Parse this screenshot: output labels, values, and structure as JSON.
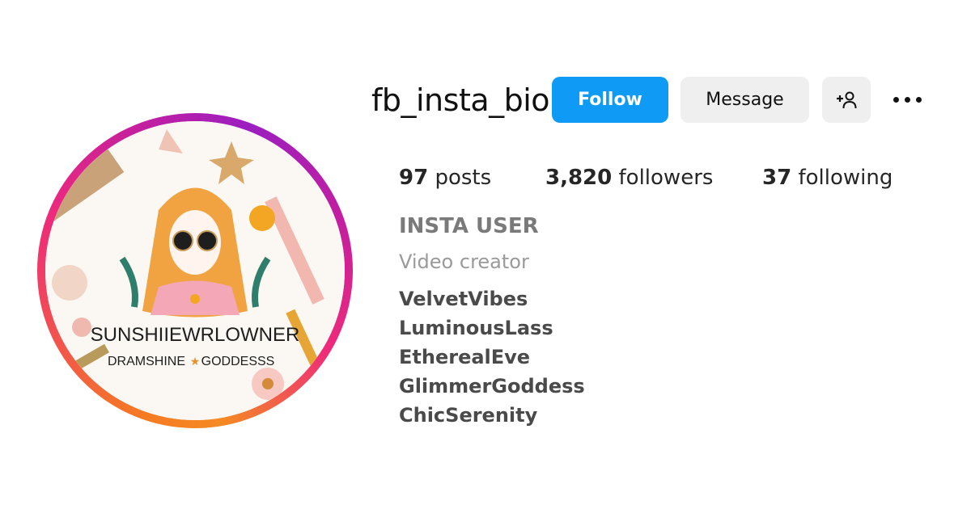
{
  "profile": {
    "username": "fb_insta_bio",
    "buttons": {
      "follow": "Follow",
      "message": "Message",
      "add_user_icon": "person-add-icon",
      "more_icon": "more-horizontal-icon"
    },
    "stats": {
      "posts_count": "97",
      "posts_label": " posts",
      "followers_count": "3,820",
      "followers_label": " followers",
      "following_count": "37",
      "following_label": " following"
    },
    "display_name": "INSTA USER",
    "category": "Video creator",
    "bio_lines": [
      "VelvetVibes",
      "LuminousLass",
      "EtherealEve",
      "GlimmerGoddess",
      "ChicSerenity"
    ],
    "avatar": {
      "title_text": "SUNSHIIEWRLOWNER",
      "subtitle_left": "DRAMSHINE",
      "subtitle_star": "★",
      "subtitle_right": "GODDESSS"
    }
  },
  "colors": {
    "follow_button": "#0f9bf5",
    "secondary_button": "#efefef",
    "ring_orange": "#f57a22",
    "ring_pink": "#ee2a7b",
    "ring_purple": "#9b1fc0"
  }
}
